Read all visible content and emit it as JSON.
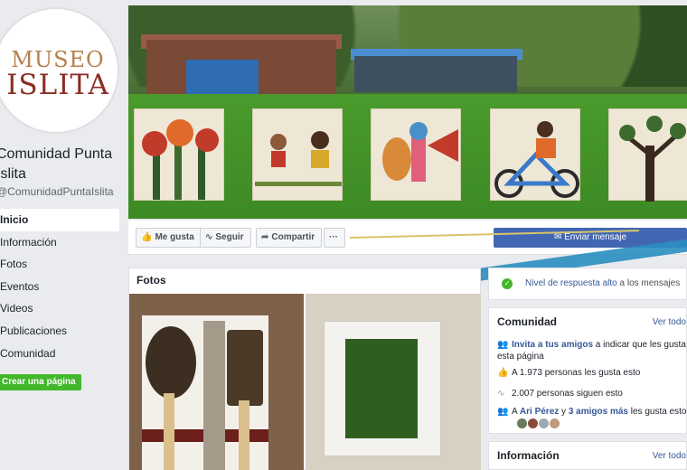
{
  "logo": {
    "line1": "MUSEO",
    "line2": "ISLITA"
  },
  "page": {
    "name": "Comunidad Punta Islita",
    "handle": "@ComunidadPuntaIslita"
  },
  "nav": [
    {
      "label": "Inicio",
      "active": true
    },
    {
      "label": "Información"
    },
    {
      "label": "Fotos"
    },
    {
      "label": "Eventos"
    },
    {
      "label": "Videos"
    },
    {
      "label": "Publicaciones"
    },
    {
      "label": "Comunidad"
    }
  ],
  "create_page": "Crear una página",
  "actions": {
    "like": "Me gusta",
    "follow": "Seguir",
    "share": "Compartir",
    "more": "···",
    "message": "Enviar mensaje"
  },
  "photos": {
    "title": "Fotos"
  },
  "response": {
    "highlight": "Nivel de respuesta alto",
    "rest": " a los mensajes"
  },
  "community": {
    "title": "Comunidad",
    "see_all": "Ver todo",
    "invite_link": "Invita a tus amigos",
    "invite_text": " a indicar que les gusta esta página",
    "likes": "A 1.973 personas les gusta esto",
    "follows": "2.007 personas siguen esto",
    "friends_pre": "A ",
    "friend_name": "Ari Pérez",
    "friends_mid": " y ",
    "friends_more": "3 amigos más",
    "friends_post": " les gusta esto"
  },
  "info": {
    "title": "Información",
    "see_all": "Ver todo"
  },
  "colors": {
    "brand_blue": "#4267b2",
    "link": "#365899",
    "green": "#42b72a"
  }
}
